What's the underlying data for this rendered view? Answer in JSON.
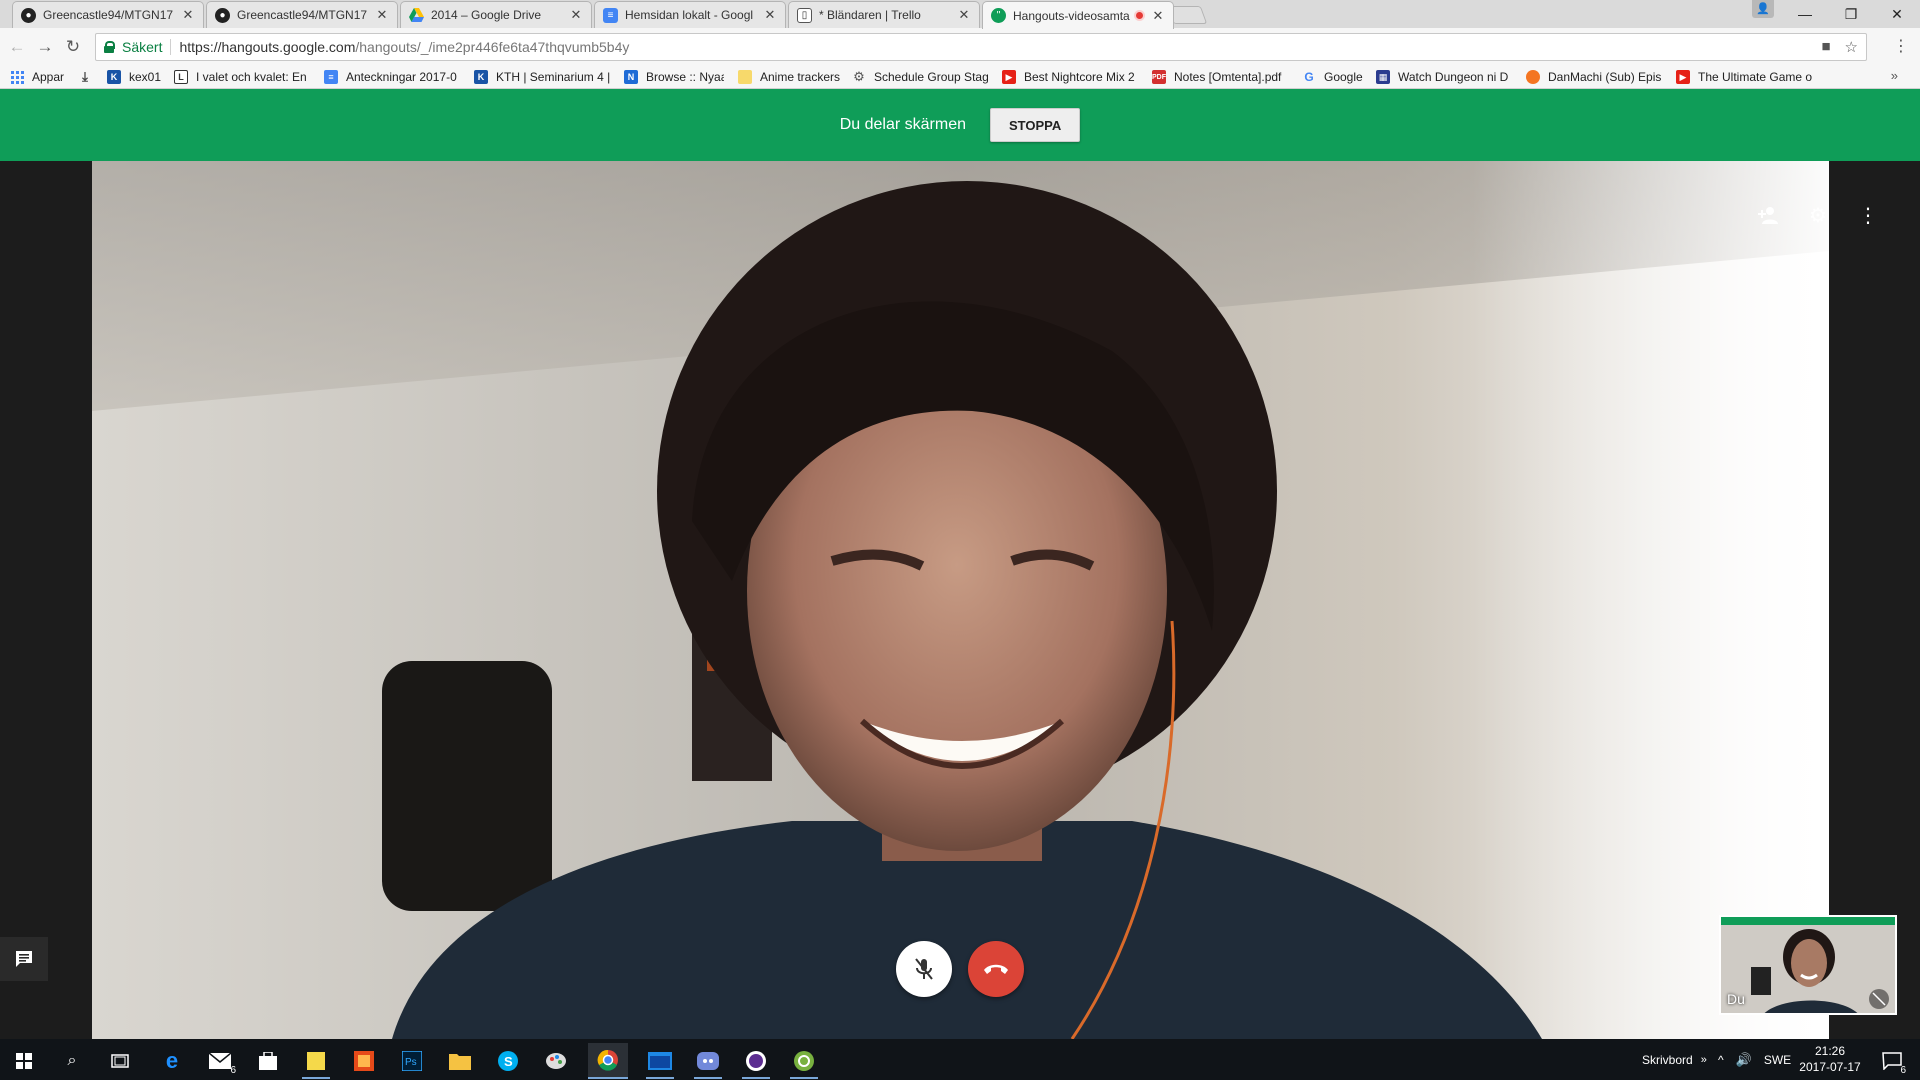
{
  "browser": {
    "tabs": [
      {
        "title": "Greencastle94/MTGN17",
        "favicon": "github-icon"
      },
      {
        "title": "Greencastle94/MTGN17",
        "favicon": "github-icon"
      },
      {
        "title": "2014 – Google Drive",
        "favicon": "google-drive-icon"
      },
      {
        "title": "Hemsidan lokalt - Googl",
        "favicon": "google-docs-icon"
      },
      {
        "title": "* Bländaren | Trello",
        "favicon": "trello-icon"
      },
      {
        "title": "Hangouts-videosamta",
        "favicon": "hangouts-icon",
        "active": true
      }
    ],
    "secure_label": "Säkert",
    "url_host": "https://hangouts.google.com",
    "url_path": "/hangouts/_/ime2pr446fe6ta47thqvumb5b4y"
  },
  "bookmarks": [
    {
      "label": "Appar",
      "icon": "apps-grid-icon"
    },
    {
      "label": "",
      "icon": "download-icon"
    },
    {
      "label": "kex01",
      "icon": "kth-icon"
    },
    {
      "label": "I valet och kvalet: En",
      "icon": "book-icon"
    },
    {
      "label": "Anteckningar 2017-0",
      "icon": "google-docs-icon"
    },
    {
      "label": "KTH | Seminarium 4 |",
      "icon": "kth-icon"
    },
    {
      "label": "Browse :: Nyaa",
      "icon": "nyaa-icon"
    },
    {
      "label": "Anime trackers",
      "icon": "folder-icon"
    },
    {
      "label": "Schedule Group Stag",
      "icon": "gear-icon"
    },
    {
      "label": "Best Nightcore Mix 2",
      "icon": "youtube-icon"
    },
    {
      "label": "Notes [Omtenta].pdf",
      "icon": "pdf-icon"
    },
    {
      "label": "Google",
      "icon": "google-icon"
    },
    {
      "label": "Watch Dungeon ni D",
      "icon": "site-icon"
    },
    {
      "label": "DanMachi (Sub) Epis",
      "icon": "crunchy-icon"
    },
    {
      "label": "The Ultimate Game o",
      "icon": "youtube-icon"
    }
  ],
  "share_banner": {
    "message": "Du delar skärmen",
    "stop_label": "STOPPA"
  },
  "call": {
    "self_label": "Du",
    "colors": {
      "banner": "#0f9d58",
      "hangup": "#db4437"
    }
  },
  "taskbar": {
    "desktop_label": "Skrivbord",
    "language": "SWE",
    "time": "21:26",
    "date": "2017-07-17",
    "mail_badge": "6",
    "notifications_badge": "6"
  }
}
